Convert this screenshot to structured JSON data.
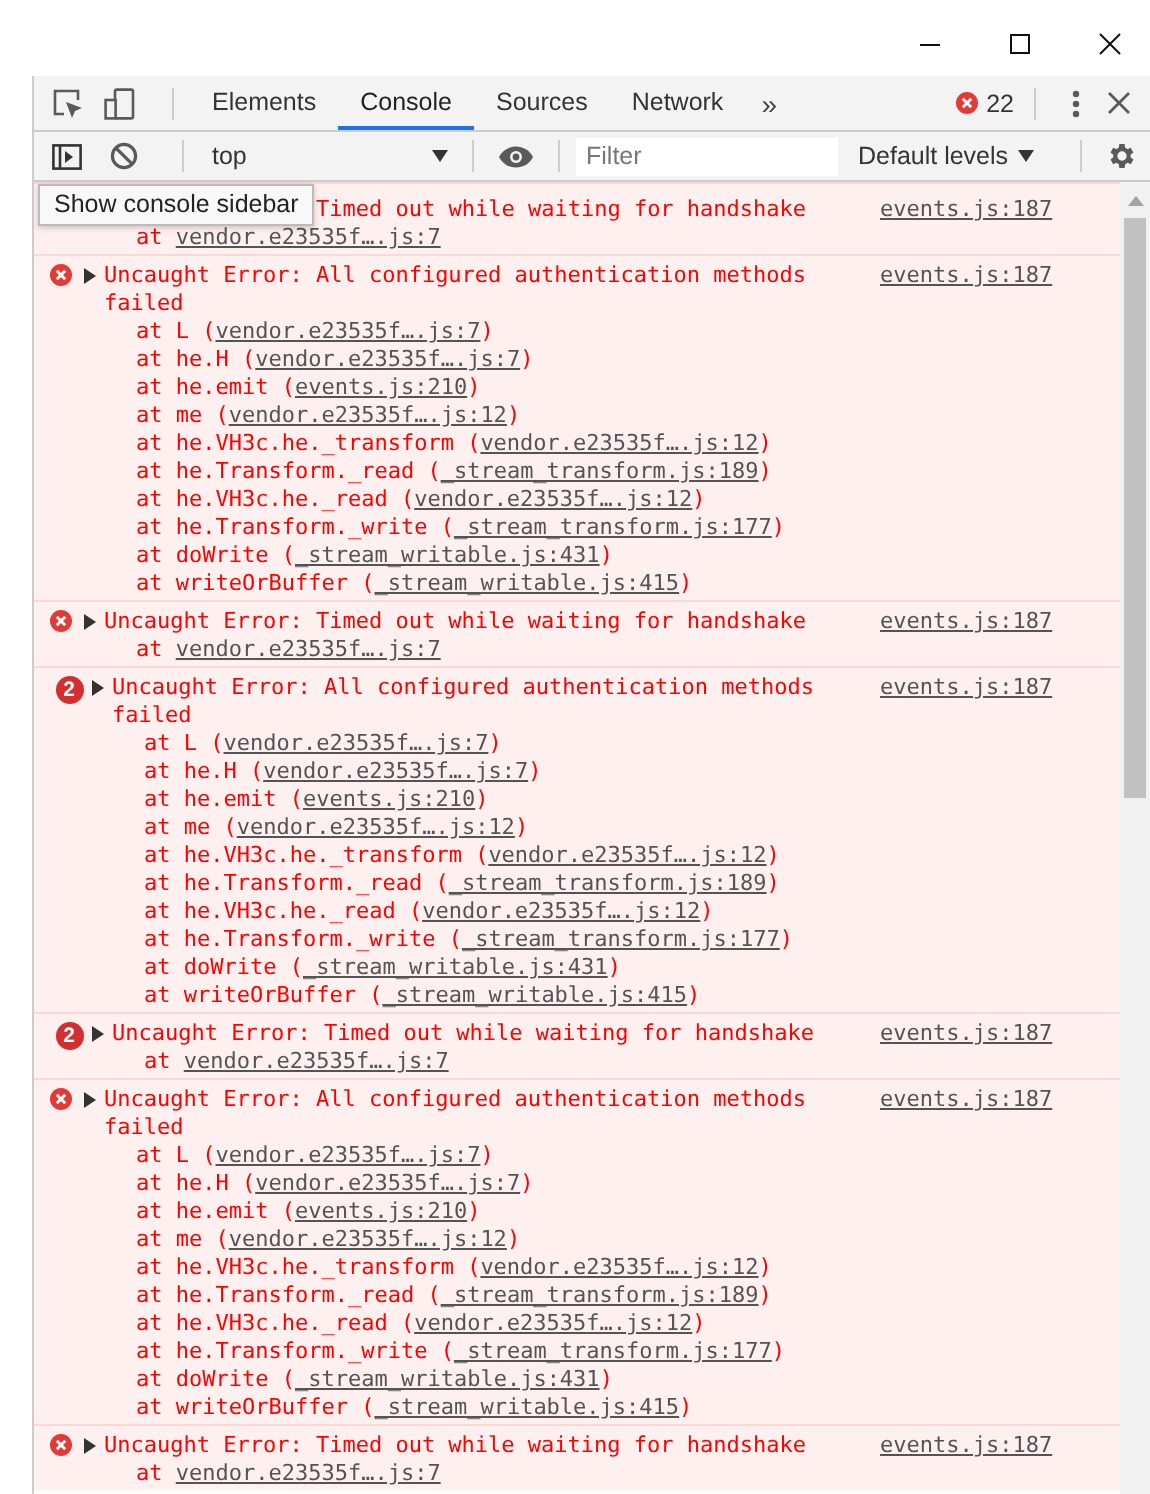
{
  "tabs": [
    {
      "label": "Elements",
      "selected": false
    },
    {
      "label": "Console",
      "selected": true
    },
    {
      "label": "Sources",
      "selected": false
    },
    {
      "label": "Network",
      "selected": false
    }
  ],
  "more_tabs": "»",
  "error_count": "22",
  "toolbar": {
    "context": "top",
    "filter": {
      "placeholder": "Filter"
    },
    "levels": "Default levels"
  },
  "tooltip": "Show console sidebar",
  "messages": [
    {
      "kind": "covered",
      "text": "Timed out while waiting for handshake",
      "source": "events.js:187",
      "stack": [
        {
          "text": "at ",
          "link": "vendor.e23535f….js:7"
        }
      ]
    },
    {
      "kind": "error",
      "text": "Uncaught Error: All configured authentication methods failed",
      "source": "events.js:187",
      "stack": [
        {
          "text": "at L (",
          "link": "vendor.e23535f….js:7",
          "end": ")"
        },
        {
          "text": "at he.H (",
          "link": "vendor.e23535f….js:7",
          "end": ")"
        },
        {
          "text": "at he.emit (",
          "link": "events.js:210",
          "end": ")"
        },
        {
          "text": "at me (",
          "link": "vendor.e23535f….js:12",
          "end": ")"
        },
        {
          "text": "at he.VH3c.he._transform (",
          "link": "vendor.e23535f….js:12",
          "end": ")"
        },
        {
          "text": "at he.Transform._read (",
          "link": "_stream_transform.js:189",
          "end": ")"
        },
        {
          "text": "at he.VH3c.he._read (",
          "link": "vendor.e23535f….js:12",
          "end": ")"
        },
        {
          "text": "at he.Transform._write (",
          "link": "_stream_transform.js:177",
          "end": ")"
        },
        {
          "text": "at doWrite (",
          "link": "_stream_writable.js:431",
          "end": ")"
        },
        {
          "text": "at writeOrBuffer (",
          "link": "_stream_writable.js:415",
          "end": ")"
        }
      ]
    },
    {
      "kind": "error",
      "text": "Uncaught Error: Timed out while waiting for handshake",
      "source": "events.js:187",
      "stack": [
        {
          "text": "at ",
          "link": "vendor.e23535f….js:7"
        }
      ]
    },
    {
      "kind": "repeated",
      "count": "2",
      "text": "Uncaught Error: All configured authentication methods failed",
      "source": "events.js:187",
      "stack": [
        {
          "text": "at L (",
          "link": "vendor.e23535f….js:7",
          "end": ")"
        },
        {
          "text": "at he.H (",
          "link": "vendor.e23535f….js:7",
          "end": ")"
        },
        {
          "text": "at he.emit (",
          "link": "events.js:210",
          "end": ")"
        },
        {
          "text": "at me (",
          "link": "vendor.e23535f….js:12",
          "end": ")"
        },
        {
          "text": "at he.VH3c.he._transform (",
          "link": "vendor.e23535f….js:12",
          "end": ")"
        },
        {
          "text": "at he.Transform._read (",
          "link": "_stream_transform.js:189",
          "end": ")"
        },
        {
          "text": "at he.VH3c.he._read (",
          "link": "vendor.e23535f….js:12",
          "end": ")"
        },
        {
          "text": "at he.Transform._write (",
          "link": "_stream_transform.js:177",
          "end": ")"
        },
        {
          "text": "at doWrite (",
          "link": "_stream_writable.js:431",
          "end": ")"
        },
        {
          "text": "at writeOrBuffer (",
          "link": "_stream_writable.js:415",
          "end": ")"
        }
      ]
    },
    {
      "kind": "repeated",
      "count": "2",
      "text": "Uncaught Error: Timed out while waiting for handshake",
      "source": "events.js:187",
      "stack": [
        {
          "text": "at ",
          "link": "vendor.e23535f….js:7"
        }
      ]
    },
    {
      "kind": "error",
      "text": "Uncaught Error: All configured authentication methods failed",
      "source": "events.js:187",
      "stack": [
        {
          "text": "at L (",
          "link": "vendor.e23535f….js:7",
          "end": ")"
        },
        {
          "text": "at he.H (",
          "link": "vendor.e23535f….js:7",
          "end": ")"
        },
        {
          "text": "at he.emit (",
          "link": "events.js:210",
          "end": ")"
        },
        {
          "text": "at me (",
          "link": "vendor.e23535f….js:12",
          "end": ")"
        },
        {
          "text": "at he.VH3c.he._transform (",
          "link": "vendor.e23535f….js:12",
          "end": ")"
        },
        {
          "text": "at he.Transform._read (",
          "link": "_stream_transform.js:189",
          "end": ")"
        },
        {
          "text": "at he.VH3c.he._read (",
          "link": "vendor.e23535f….js:12",
          "end": ")"
        },
        {
          "text": "at he.Transform._write (",
          "link": "_stream_transform.js:177",
          "end": ")"
        },
        {
          "text": "at doWrite (",
          "link": "_stream_writable.js:431",
          "end": ")"
        },
        {
          "text": "at writeOrBuffer (",
          "link": "_stream_writable.js:415",
          "end": ")"
        }
      ]
    },
    {
      "kind": "error",
      "text": "Uncaught Error: Timed out while waiting for handshake",
      "source": "events.js:187",
      "stack": [
        {
          "text": "at ",
          "link": "vendor.e23535f….js:7"
        }
      ]
    }
  ]
}
